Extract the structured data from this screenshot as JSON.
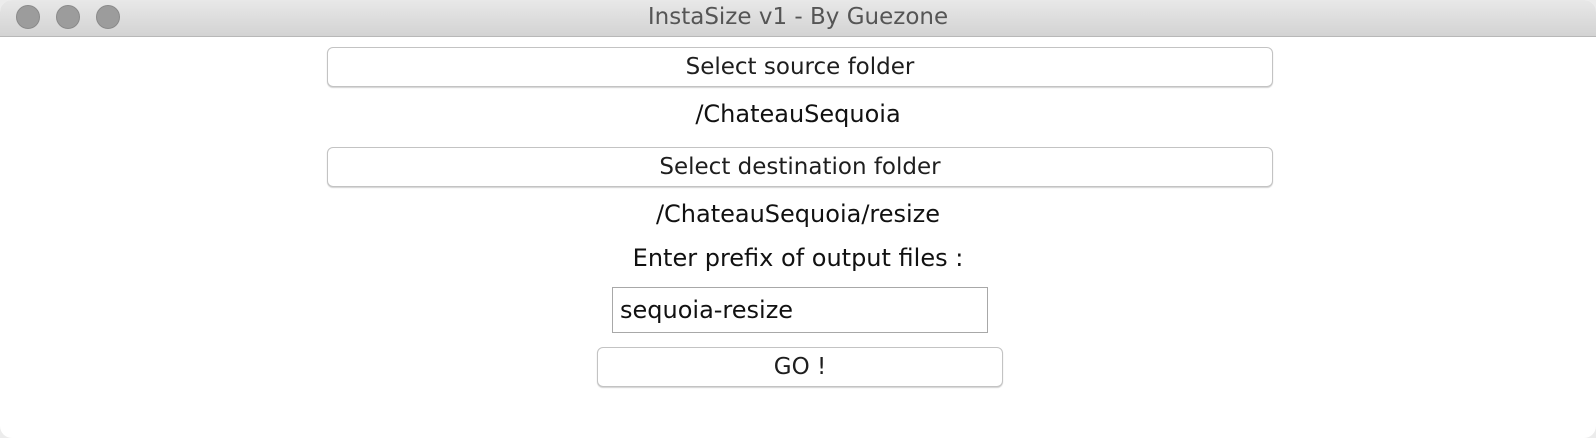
{
  "window": {
    "title": "InstaSize v1 - By Guezone"
  },
  "source": {
    "button_label": "Select source folder",
    "path": "/ChateauSequoia"
  },
  "destination": {
    "button_label": "Select destination folder",
    "path": "/ChateauSequoia/resize"
  },
  "prefix": {
    "label": "Enter prefix of output files :",
    "value": "sequoia-resize"
  },
  "actions": {
    "go_label": "GO !"
  }
}
